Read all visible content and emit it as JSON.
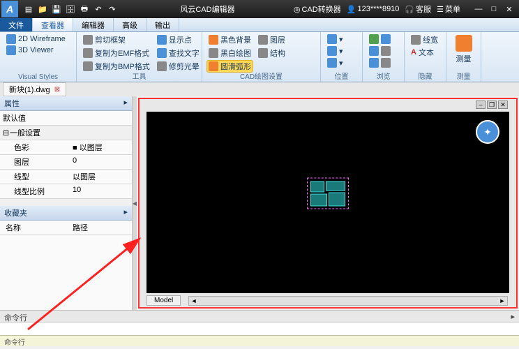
{
  "titlebar": {
    "app_title": "风云CAD编辑器",
    "converter_label": "CAD转换器",
    "user": "123****8910",
    "support": "客服",
    "menu_label": "菜单",
    "qat_icons": [
      "new-icon",
      "open-icon",
      "save-icon",
      "saveall-icon",
      "print-icon",
      "undo-icon",
      "redo-icon"
    ]
  },
  "menubar": {
    "items": [
      "文件",
      "查看器",
      "编辑器",
      "高级",
      "输出"
    ]
  },
  "tabs": {
    "file": "文件",
    "active": "查看器",
    "others": [
      "编辑器",
      "高级",
      "输出"
    ]
  },
  "ribbon": {
    "visual": {
      "wireframe2d": "2D Wireframe",
      "viewer3d": "3D Viewer",
      "label": "Visual Styles"
    },
    "tools": {
      "cut_frame": "剪切框架",
      "copy_emf": "复制为EMF格式",
      "copy_bmp": "复制为BMP格式",
      "show_point": "显示点",
      "find_text": "查找文字",
      "edit_poly": "修剪光晕",
      "label": "工具"
    },
    "draw": {
      "black_bg": "黑色背景",
      "bw_draw": "黑白绘图",
      "smooth_arc": "圆滑弧形",
      "layer": "图层",
      "struct": "结构",
      "label": "CAD绘图设置"
    },
    "position": {
      "label": "位置"
    },
    "browse": {
      "label": "浏览"
    },
    "hide": {
      "wire": "线宽",
      "text": "文本",
      "label": "隐藏"
    },
    "measure": {
      "big": "测量",
      "sub": "测量",
      "label": "测量"
    }
  },
  "doctab": {
    "name": "新块(1).dwg"
  },
  "panel": {
    "attr_header": "属性",
    "default": "默认值",
    "general": "一般设置",
    "rows": [
      {
        "k": "色彩",
        "v": "■ 以图层"
      },
      {
        "k": "图层",
        "v": "0"
      },
      {
        "k": "线型",
        "v": "以图层"
      },
      {
        "k": "线型比例",
        "v": "10"
      }
    ],
    "fav_header": "收藏夹",
    "fav_cols": {
      "name": "名称",
      "path": "路径"
    }
  },
  "viewport": {
    "model_tab": "Model"
  },
  "cmdline": {
    "label": "命令行"
  },
  "bottom": {
    "label": "命令行"
  }
}
